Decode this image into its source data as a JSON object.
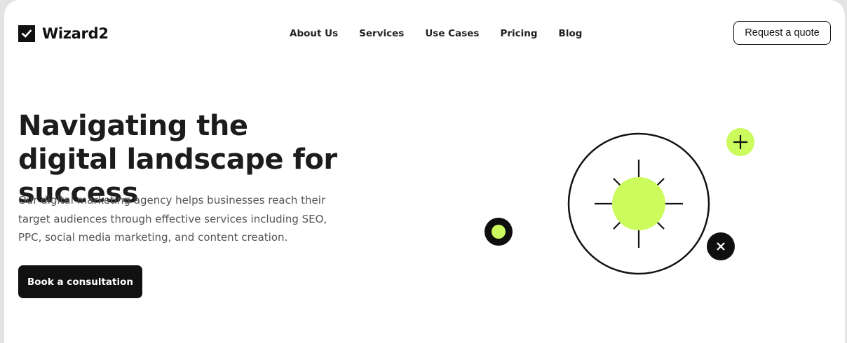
{
  "brand": {
    "name": "Wizard2",
    "logo_icon": "checkmark-icon"
  },
  "nav": {
    "items": [
      "About Us",
      "Services",
      "Use Cases",
      "Pricing",
      "Blog"
    ]
  },
  "header": {
    "quote_button": "Request a quote"
  },
  "hero": {
    "title": "Navigating the digital landscape for success",
    "description": "Our digital marketing agency helps businesses reach their target audiences through effective services including SEO, PPC, social media marketing, and content creation.",
    "cta": "Book a consultation"
  },
  "illustration": {
    "icons": [
      "sun-icon",
      "plus-icon",
      "close-icon",
      "dot-icon"
    ],
    "accent_color": "#cbfb5d",
    "dark_color": "#0f0f0f"
  },
  "colors": {
    "background": "#ffffff",
    "text": "#1c1c1c",
    "button": "#111111"
  }
}
